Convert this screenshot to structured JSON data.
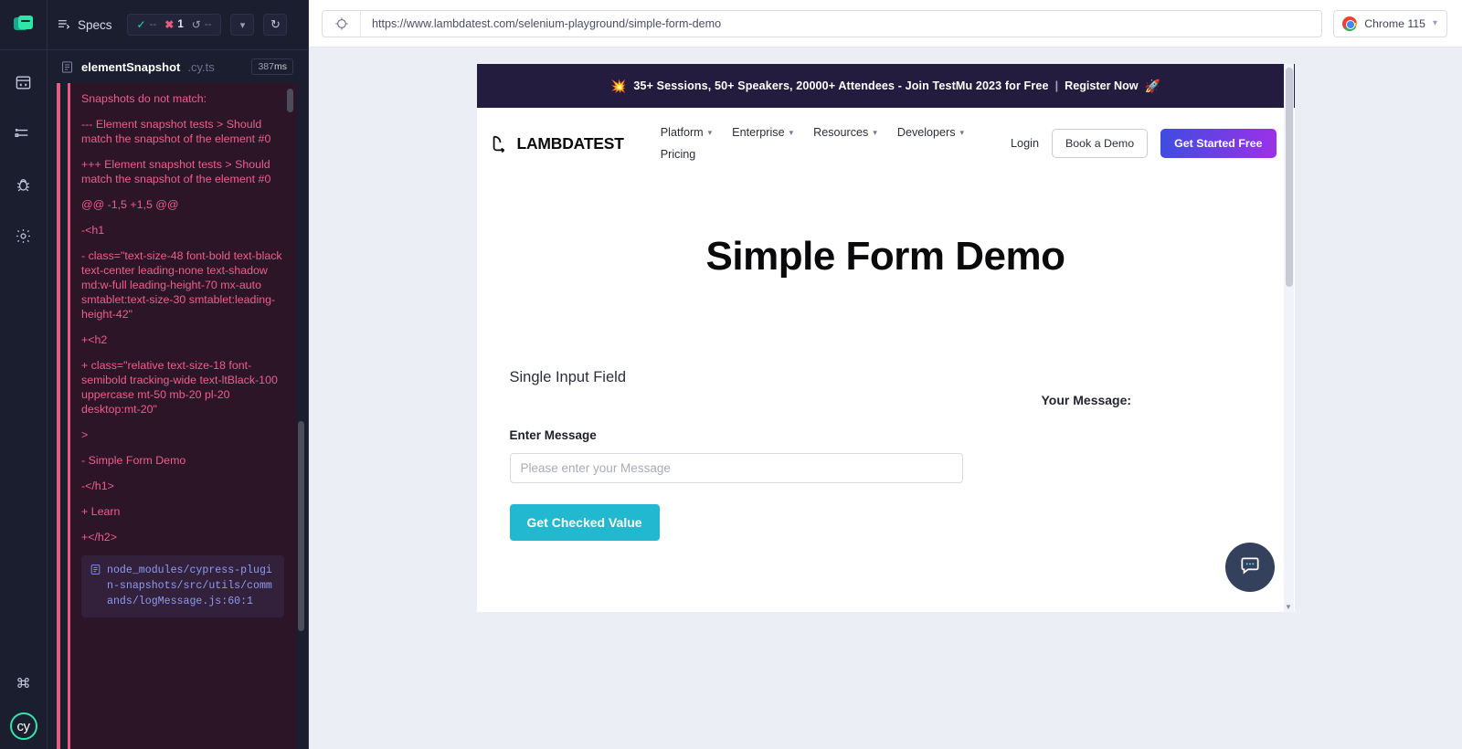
{
  "rail": {
    "logo_name": "cypress-logo",
    "items": [
      {
        "name": "specs-icon",
        "label": "Specs"
      },
      {
        "name": "runs-icon",
        "label": "Runs"
      },
      {
        "name": "debug-icon",
        "label": "Debug"
      },
      {
        "name": "settings-icon",
        "label": "Settings"
      }
    ],
    "shortcut_label": "Keyboard shortcuts",
    "cy_label": "cy"
  },
  "reporter": {
    "specs_button": "Specs",
    "stats": {
      "passed": "--",
      "failed": "1",
      "pending": "--"
    },
    "collapse_label": "Collapse all",
    "reload_label": "Run all tests",
    "spec": {
      "name": "elementSnapshot",
      "ext": ".cy.ts",
      "duration_value": "387",
      "duration_unit": "ms"
    },
    "error": {
      "lines": [
        "Snapshots do not match:",
        "--- Element snapshot tests > Should match the snapshot of the element #0",
        "+++ Element snapshot tests > Should match the snapshot of the element #0",
        "@@ -1,5 +1,5 @@",
        "-<h1",
        "-  class=\"text-size-48 font-bold text-black text-center leading-none text-shadow md:w-full leading-height-70 mx-auto smtablet:text-size-30 smtablet:leading-height-42\"",
        "+<h2",
        "+  class=\"relative text-size-18 font-semibold tracking-wide text-ltBlack-100 uppercase mt-50 mb-20 pl-20 desktop:mt-20\"",
        ">",
        "-  Simple Form Demo",
        "-</h1>",
        "+  Learn",
        "+</h2>"
      ],
      "code_frame_link": "node_modules/cypress-plugin-snapshots/src/utils/commands/logMessage.js:60:1"
    }
  },
  "browser": {
    "url": "https://www.lambdatest.com/selenium-playground/simple-form-demo",
    "browser_name": "Chrome 115"
  },
  "site": {
    "promo": {
      "emoji": "💥",
      "text": "35+ Sessions, 50+ Speakers, 20000+ Attendees - Join TestMu 2023 for Free",
      "separator": "|",
      "cta": "Register Now",
      "rocket": "🚀"
    },
    "brand": "LAMBDATEST",
    "nav_row1": [
      "Platform",
      "Enterprise",
      "Resources",
      "Developers"
    ],
    "nav_row2": [
      "Pricing"
    ],
    "login": "Login",
    "book_demo": "Book a Demo",
    "get_started": "Get Started Free",
    "page_title": "Simple Form Demo",
    "section_title": "Single Input Field",
    "field_label": "Enter Message",
    "field_value": "",
    "field_placeholder": "Please enter your Message",
    "submit_button": "Get Checked Value",
    "result_label": "Your Message:",
    "result_value": "",
    "chat_label": "Open chat"
  },
  "colors": {
    "cypress_green": "#2ee6a8",
    "fail_pink": "#e45c7f",
    "error_bg": "#2b1526",
    "error_text": "#ef5d8f",
    "promo_bg": "#231c3f",
    "submit_teal": "#22b8cf",
    "gsf_gradient_start": "#3f4ce0",
    "gsf_gradient_end": "#9b31e8"
  }
}
